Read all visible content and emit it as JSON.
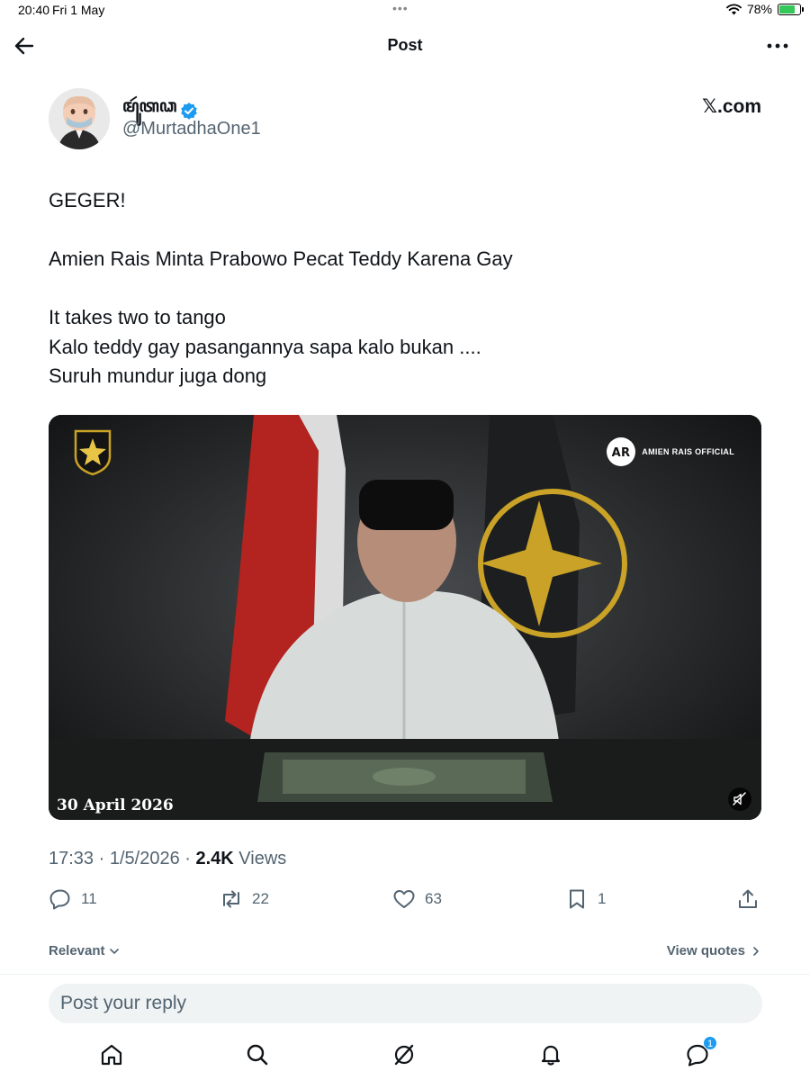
{
  "status_bar": {
    "time": "20:40",
    "date": "Fri 1 May",
    "dots": "•••",
    "battery": "78%",
    "battery_level": 0.78
  },
  "nav": {
    "title": "Post"
  },
  "author": {
    "name": "ꦩꦸꦂꦠꦣ",
    "handle": "@MurtadhaOne1",
    "verified": true,
    "source_logo": "𝕏.com"
  },
  "tweet": {
    "lines": [
      "GEGER!",
      "",
      "Amien Rais Minta Prabowo Pecat Teddy Karena Gay",
      "",
      "It takes two to tango",
      "Kalo teddy gay pasangannya sapa kalo bukan ....",
      "Suruh mundur juga dong"
    ]
  },
  "media": {
    "date_overlay": "30 April 2026",
    "channel_name": "AMIEN RAIS OFFICIAL",
    "channel_logo_text": "AR"
  },
  "meta": {
    "time": "17:33",
    "separator": " · ",
    "date": "1/5/2026",
    "views_count": "2.4K",
    "views_label": "Views"
  },
  "actions": {
    "replies": "11",
    "reposts": "22",
    "likes": "63",
    "bookmarks": "1"
  },
  "sort": {
    "relevant": "Relevant",
    "view_quotes": "View quotes"
  },
  "reply": {
    "placeholder": "Post your reply"
  },
  "tabs": {
    "messages_badge": "1"
  },
  "colors": {
    "accent": "#1d9bf0",
    "text_secondary": "#536471",
    "text_primary": "#0f1419"
  }
}
